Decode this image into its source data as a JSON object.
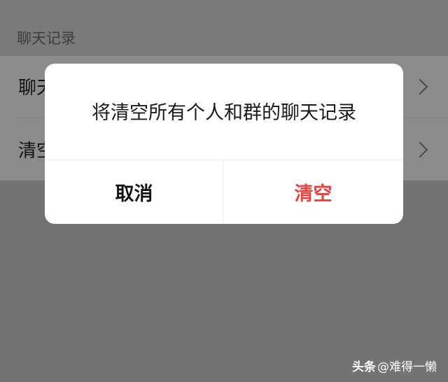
{
  "section": {
    "header": "聊天记录"
  },
  "settings": {
    "rows": [
      {
        "label": "聊天"
      },
      {
        "label": "清空"
      }
    ]
  },
  "dialog": {
    "message": "将清空所有个人和群的聊天记录",
    "cancel_label": "取消",
    "confirm_label": "清空",
    "confirm_color": "#e8423f"
  },
  "watermark": {
    "brand": "头条",
    "handle": "@难得一懒"
  }
}
